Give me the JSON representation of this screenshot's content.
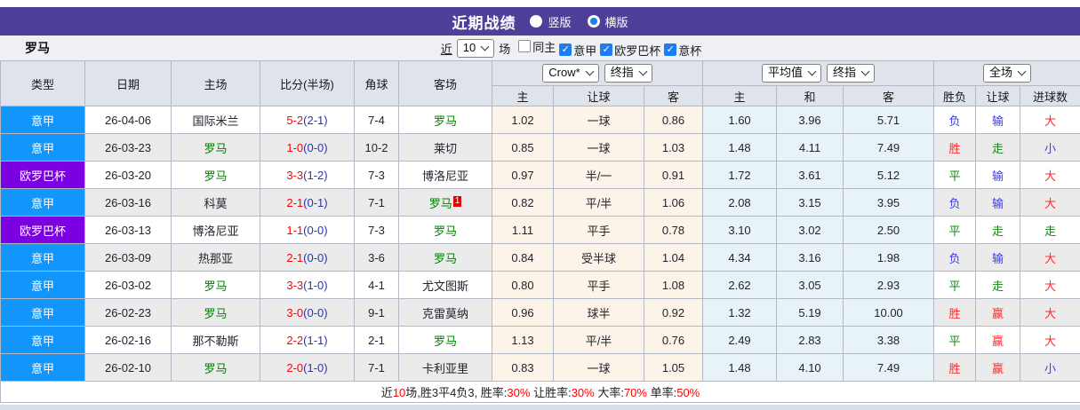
{
  "titlebar": {
    "title": "近期战绩",
    "radios": [
      {
        "label": "竖版",
        "selected": false
      },
      {
        "label": "横版",
        "selected": true
      }
    ]
  },
  "filterbar": {
    "team": "罗马",
    "prefix_link": "近",
    "match_count": "10",
    "suffix": "场",
    "checkboxes": [
      {
        "label": "同主",
        "checked": false
      },
      {
        "label": "意甲",
        "checked": true
      },
      {
        "label": "欧罗巴杯",
        "checked": true
      },
      {
        "label": "意杯",
        "checked": true
      }
    ]
  },
  "table": {
    "left_headers": [
      "类型",
      "日期",
      "主场",
      "比分(半场)",
      "角球",
      "客场"
    ],
    "selects": {
      "odds_company": "Crow*",
      "odds_stage": "终指",
      "avg_label": "平均值",
      "avg_stage": "终指",
      "scope": "全场"
    },
    "sub_headers": [
      "主",
      "让球",
      "客",
      "主",
      "和",
      "客",
      "胜负",
      "让球",
      "进球数"
    ],
    "rows": [
      {
        "league": "意甲",
        "league_color": "blue",
        "date": "26-04-06",
        "home": "国际米兰",
        "home_green": false,
        "score": "5-2",
        "half": "(2-1)",
        "corners": "7-4",
        "away": "罗马",
        "away_green": true,
        "away_badge": "",
        "odds": [
          "1.02",
          "一球",
          "0.86"
        ],
        "avg": [
          "1.60",
          "3.96",
          "5.71"
        ],
        "results": [
          {
            "t": "负",
            "c": "blue"
          },
          {
            "t": "输",
            "c": "blue"
          },
          {
            "t": "大",
            "c": "red"
          }
        ]
      },
      {
        "league": "意甲",
        "league_color": "blue",
        "date": "26-03-23",
        "home": "罗马",
        "home_green": true,
        "score": "1-0",
        "half": "(0-0)",
        "corners": "10-2",
        "away": "莱切",
        "away_green": false,
        "away_badge": "",
        "odds": [
          "0.85",
          "一球",
          "1.03"
        ],
        "avg": [
          "1.48",
          "4.11",
          "7.49"
        ],
        "results": [
          {
            "t": "胜",
            "c": "red"
          },
          {
            "t": "走",
            "c": "green"
          },
          {
            "t": "小",
            "c": "blue"
          }
        ]
      },
      {
        "league": "欧罗巴杯",
        "league_color": "purple",
        "date": "26-03-20",
        "home": "罗马",
        "home_green": true,
        "score": "3-3",
        "half": "(1-2)",
        "corners": "7-3",
        "away": "博洛尼亚",
        "away_green": false,
        "away_badge": "",
        "odds": [
          "0.97",
          "半/一",
          "0.91"
        ],
        "avg": [
          "1.72",
          "3.61",
          "5.12"
        ],
        "results": [
          {
            "t": "平",
            "c": "green"
          },
          {
            "t": "输",
            "c": "blue"
          },
          {
            "t": "大",
            "c": "red"
          }
        ]
      },
      {
        "league": "意甲",
        "league_color": "blue",
        "date": "26-03-16",
        "home": "科莫",
        "home_green": false,
        "score": "2-1",
        "half": "(0-1)",
        "corners": "7-1",
        "away": "罗马",
        "away_green": true,
        "away_badge": "1",
        "odds": [
          "0.82",
          "平/半",
          "1.06"
        ],
        "avg": [
          "2.08",
          "3.15",
          "3.95"
        ],
        "results": [
          {
            "t": "负",
            "c": "blue"
          },
          {
            "t": "输",
            "c": "blue"
          },
          {
            "t": "大",
            "c": "red"
          }
        ]
      },
      {
        "league": "欧罗巴杯",
        "league_color": "purple",
        "date": "26-03-13",
        "home": "博洛尼亚",
        "home_green": false,
        "score": "1-1",
        "half": "(0-0)",
        "corners": "7-3",
        "away": "罗马",
        "away_green": true,
        "away_badge": "",
        "odds": [
          "1.11",
          "平手",
          "0.78"
        ],
        "avg": [
          "3.10",
          "3.02",
          "2.50"
        ],
        "results": [
          {
            "t": "平",
            "c": "green"
          },
          {
            "t": "走",
            "c": "green"
          },
          {
            "t": "走",
            "c": "green"
          }
        ]
      },
      {
        "league": "意甲",
        "league_color": "blue",
        "date": "26-03-09",
        "home": "热那亚",
        "home_green": false,
        "score": "2-1",
        "half": "(0-0)",
        "corners": "3-6",
        "away": "罗马",
        "away_green": true,
        "away_badge": "",
        "odds": [
          "0.84",
          "受半球",
          "1.04"
        ],
        "avg": [
          "4.34",
          "3.16",
          "1.98"
        ],
        "results": [
          {
            "t": "负",
            "c": "blue"
          },
          {
            "t": "输",
            "c": "blue"
          },
          {
            "t": "大",
            "c": "red"
          }
        ]
      },
      {
        "league": "意甲",
        "league_color": "blue",
        "date": "26-03-02",
        "home": "罗马",
        "home_green": true,
        "score": "3-3",
        "half": "(1-0)",
        "corners": "4-1",
        "away": "尤文图斯",
        "away_green": false,
        "away_badge": "",
        "odds": [
          "0.80",
          "平手",
          "1.08"
        ],
        "avg": [
          "2.62",
          "3.05",
          "2.93"
        ],
        "results": [
          {
            "t": "平",
            "c": "green"
          },
          {
            "t": "走",
            "c": "green"
          },
          {
            "t": "大",
            "c": "red"
          }
        ]
      },
      {
        "league": "意甲",
        "league_color": "blue",
        "date": "26-02-23",
        "home": "罗马",
        "home_green": true,
        "score": "3-0",
        "half": "(0-0)",
        "corners": "9-1",
        "away": "克雷莫纳",
        "away_green": false,
        "away_badge": "",
        "odds": [
          "0.96",
          "球半",
          "0.92"
        ],
        "avg": [
          "1.32",
          "5.19",
          "10.00"
        ],
        "results": [
          {
            "t": "胜",
            "c": "red"
          },
          {
            "t": "赢",
            "c": "red"
          },
          {
            "t": "大",
            "c": "red"
          }
        ]
      },
      {
        "league": "意甲",
        "league_color": "blue",
        "date": "26-02-16",
        "home": "那不勒斯",
        "home_green": false,
        "score": "2-2",
        "half": "(1-1)",
        "corners": "2-1",
        "away": "罗马",
        "away_green": true,
        "away_badge": "",
        "odds": [
          "1.13",
          "平/半",
          "0.76"
        ],
        "avg": [
          "2.49",
          "2.83",
          "3.38"
        ],
        "results": [
          {
            "t": "平",
            "c": "green"
          },
          {
            "t": "赢",
            "c": "red"
          },
          {
            "t": "大",
            "c": "red"
          }
        ]
      },
      {
        "league": "意甲",
        "league_color": "blue",
        "date": "26-02-10",
        "home": "罗马",
        "home_green": true,
        "score": "2-0",
        "half": "(1-0)",
        "corners": "7-1",
        "away": "卡利亚里",
        "away_green": false,
        "away_badge": "",
        "odds": [
          "0.83",
          "一球",
          "1.05"
        ],
        "avg": [
          "1.48",
          "4.10",
          "7.49"
        ],
        "results": [
          {
            "t": "胜",
            "c": "red"
          },
          {
            "t": "赢",
            "c": "red"
          },
          {
            "t": "小",
            "c": "blue"
          }
        ]
      }
    ]
  },
  "summary": {
    "segments": [
      {
        "text": "近",
        "red": false
      },
      {
        "text": "10",
        "red": true
      },
      {
        "text": "场,胜3平4负3, 胜率:",
        "red": false
      },
      {
        "text": "30%",
        "red": true
      },
      {
        "text": " 让胜率:",
        "red": false
      },
      {
        "text": "30%",
        "red": true
      },
      {
        "text": " 大率:",
        "red": false
      },
      {
        "text": "70%",
        "red": true
      },
      {
        "text": " 单率:",
        "red": false
      },
      {
        "text": "50%",
        "red": true
      }
    ]
  },
  "colors": {
    "titlebar_bg": "#4f3f9b",
    "league_serie_a": "#1296fb",
    "league_europa": "#7b00e2",
    "roma_green": "#008000",
    "score_red": "#ff0000",
    "half_score_navy": "#2e35a3",
    "result_red": "#ff2b2b",
    "result_blue": "#3a3af2",
    "result_green": "#108c10",
    "odds_bg": "#fcf4e8",
    "avg_bg": "#e8f3f8",
    "checkbox_blue": "#1d7df2"
  }
}
